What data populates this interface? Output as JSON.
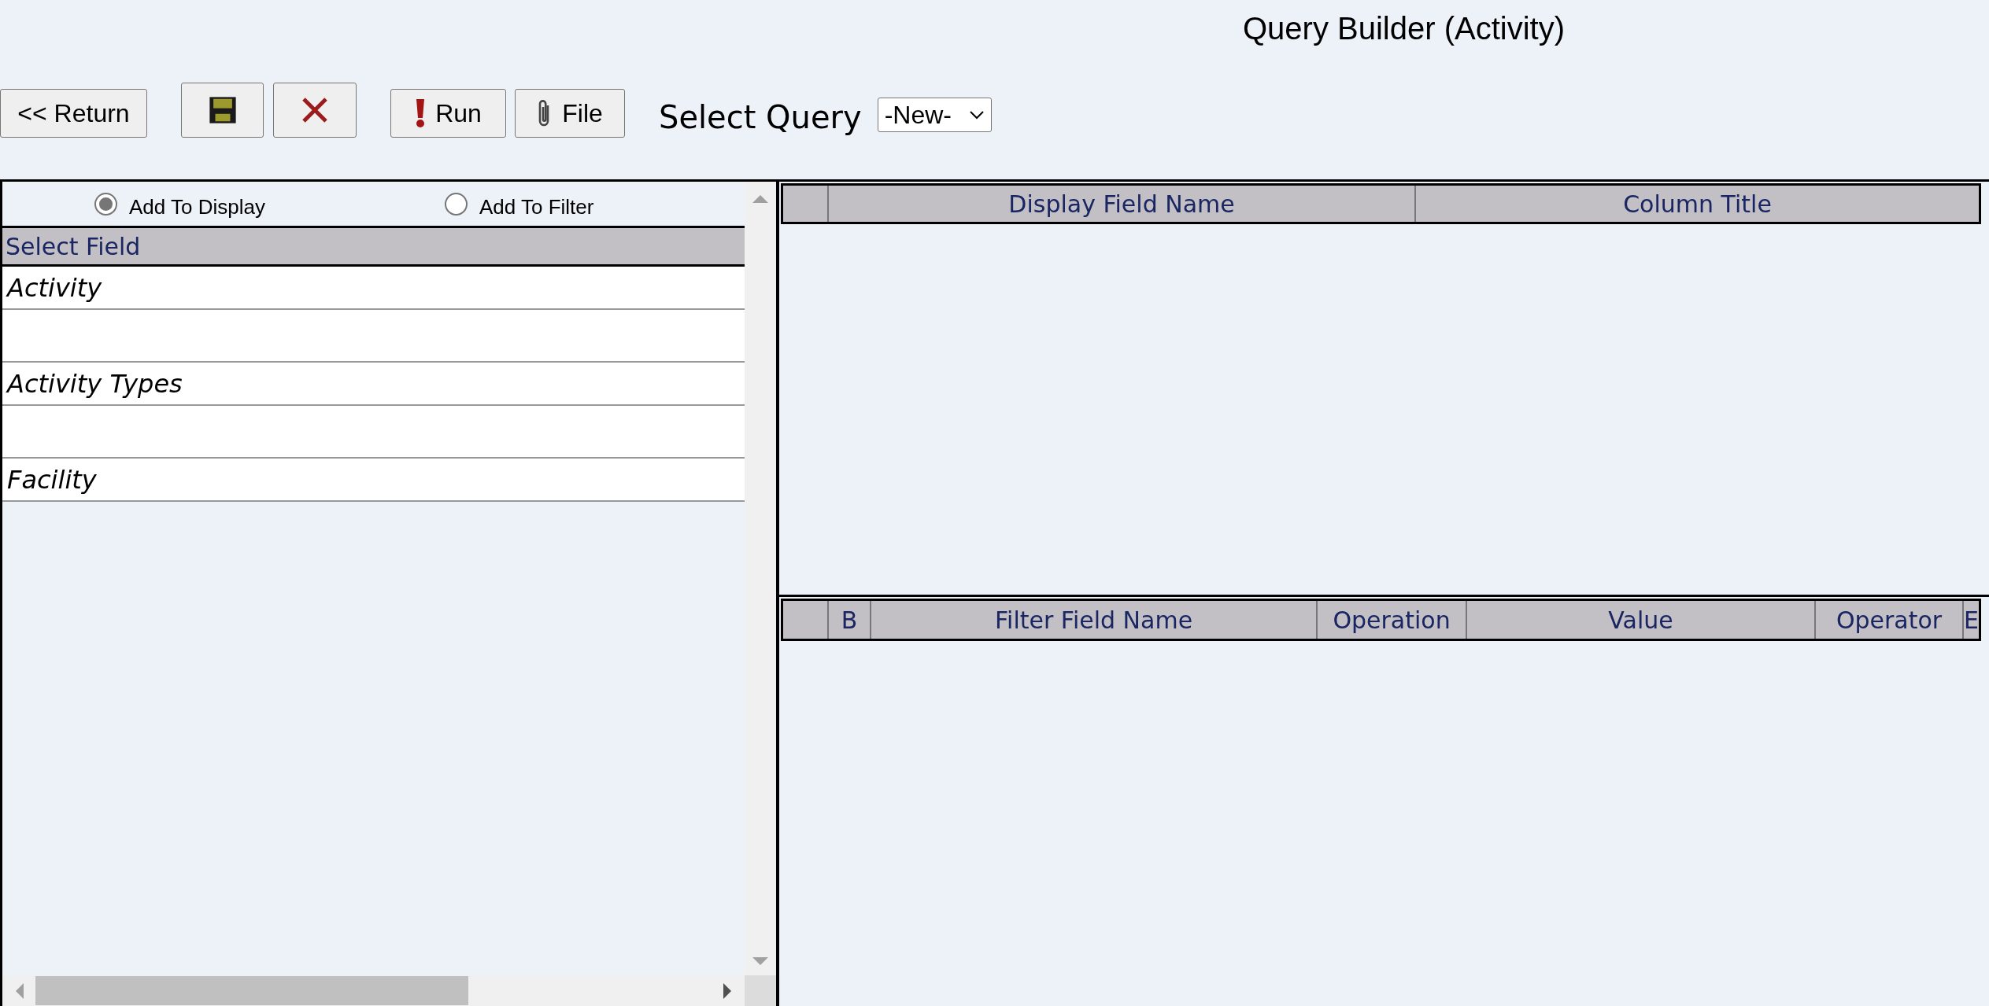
{
  "title": "Query Builder (Activity)",
  "toolbar": {
    "return_label": "<< Return",
    "run_label": "Run",
    "file_label": "File",
    "select_query_label": "Select Query",
    "select_query_value": "-New-"
  },
  "add_mode": [
    {
      "label": "Add To Display",
      "selected": true
    },
    {
      "label": "Add To Filter",
      "selected": false
    }
  ],
  "field_list": {
    "header": "Select Field",
    "items": [
      {
        "label": "Activity"
      },
      {
        "label": "Activity Types"
      },
      {
        "label": "Facility"
      }
    ]
  },
  "display_table": {
    "columns": [
      "",
      "Display Field Name",
      "Column Title"
    ]
  },
  "filter_table": {
    "columns": [
      "",
      "B",
      "Filter Field Name",
      "Operation",
      "Value",
      "Operator",
      "E"
    ]
  }
}
